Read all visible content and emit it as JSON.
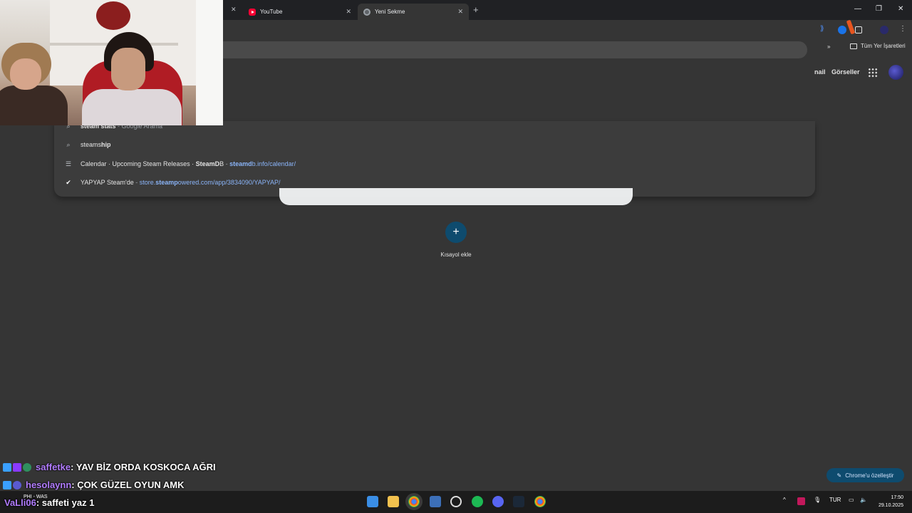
{
  "tabs": [
    {
      "title": "YouTube",
      "icon": "youtube-icon",
      "active": false
    },
    {
      "title": "Yeni Sekme",
      "icon": "chrome-icon",
      "active": true
    }
  ],
  "bookmarks": {
    "all_bookmarks": "Tüm Yer İşaretleri",
    "overflow": "»"
  },
  "suggestions": [
    {
      "icon": "search-icon",
      "text_bold": "steam stats",
      "separator": " - ",
      "secondary": "Google Arama",
      "url": ""
    },
    {
      "icon": "search-icon",
      "text_plain": "steams",
      "text_bold": "hip",
      "url": ""
    },
    {
      "icon": "database-icon",
      "title_plain": "Calendar · Upcoming Steam Releases · ",
      "title_bold": "SteamD",
      "title_tail": "B",
      "separator": " - ",
      "url_bold": "steamd",
      "url_rest": "b.info/calendar/"
    },
    {
      "icon": "steam-icon",
      "title_plain": "YAPYAP Steam'de",
      "separator": " - ",
      "url_pre": "store.",
      "url_bold": "steamp",
      "url_rest": "owered.com/app/3834090/YAPYAP/"
    }
  ],
  "google_links": {
    "gmail": "nail",
    "images": "Görseller"
  },
  "shortcut": {
    "add_label": "Kısayol ekle",
    "plus": "+"
  },
  "customize_button": "Chrome'u özelleştir",
  "chat": [
    {
      "user": "saffetke",
      "message": ": YAV BİZ ORDA KOSKOCA AĞRI"
    },
    {
      "user": "hesolaynn",
      "message": ": ÇOK GÜZEL OYUN AMK"
    },
    {
      "user": "VaLli06",
      "message": ": saffeti yaz 1"
    }
  ],
  "taskbar": {
    "weather": "PHI - WAS",
    "language": "TUR",
    "time": "17:50",
    "date": "29.10.2025"
  },
  "colors": {
    "accent": "#0e4b6e",
    "chat_user": "#b27dff",
    "url": "#8ab4f8"
  }
}
